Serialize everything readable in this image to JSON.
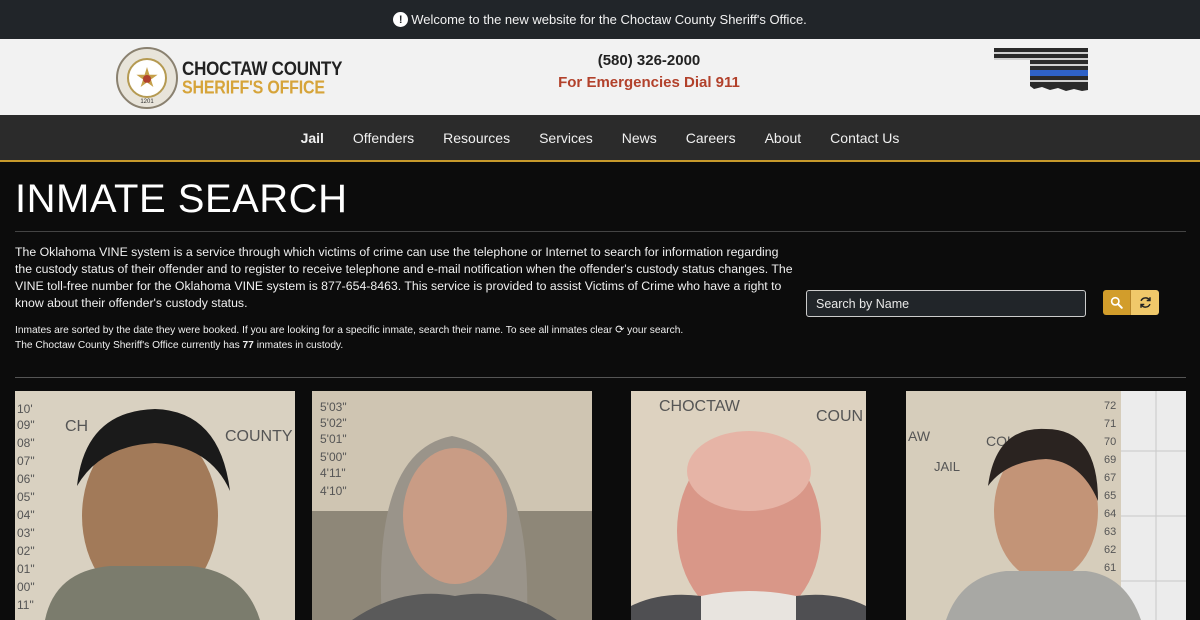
{
  "announcement": {
    "text": "Welcome to the new website for the Choctaw County Sheriff's Office.",
    "icon": "exclamation-circle-icon"
  },
  "header": {
    "logo_line1": "CHOCTAW COUNTY",
    "logo_line2": "SHERIFF'S OFFICE",
    "badge_number": "1201",
    "phone": "(580) 326-2000",
    "emergency": "For Emergencies Dial 911",
    "flag_icon": "oklahoma-thin-blue-line-flag-icon"
  },
  "nav": {
    "items": [
      {
        "label": "Jail",
        "active": true
      },
      {
        "label": "Offenders"
      },
      {
        "label": "Resources"
      },
      {
        "label": "Services"
      },
      {
        "label": "News"
      },
      {
        "label": "Careers"
      },
      {
        "label": "About"
      },
      {
        "label": "Contact Us"
      }
    ]
  },
  "main": {
    "title": "INMATE SEARCH",
    "intro": "The Oklahoma VINE system is a service through which victims of crime can use the telephone or Internet to search for information regarding the custody status of their offender and to register to receive telephone and e-mail notification when the offender's custody status changes. The VINE toll-free number for the Oklahoma VINE system is 877-654-8463. This service is provided to assist Victims of Crime who have a right to know about their offender's custody status.",
    "sort_note_before": "Inmates are sorted by the date they were booked. If you are looking for a specific inmate, search their name. To see all inmates clear",
    "sort_note_after": "your search.",
    "custody_before": "The Choctaw County Sheriff's Office currently has",
    "custody_count": "77",
    "custody_after": "inmates in custody.",
    "search": {
      "placeholder": "Search by Name",
      "value": ""
    },
    "search_button_icon": "search-icon",
    "reset_button_icon": "refresh-icon"
  },
  "colors": {
    "accent": "#c89a2c",
    "emergency": "#b2412b",
    "button": "#d29d2b"
  },
  "mugshots": [
    {
      "alt": "inmate-photo-1"
    },
    {
      "alt": "inmate-photo-2"
    },
    {
      "alt": "inmate-photo-3"
    },
    {
      "alt": "inmate-photo-4"
    }
  ]
}
